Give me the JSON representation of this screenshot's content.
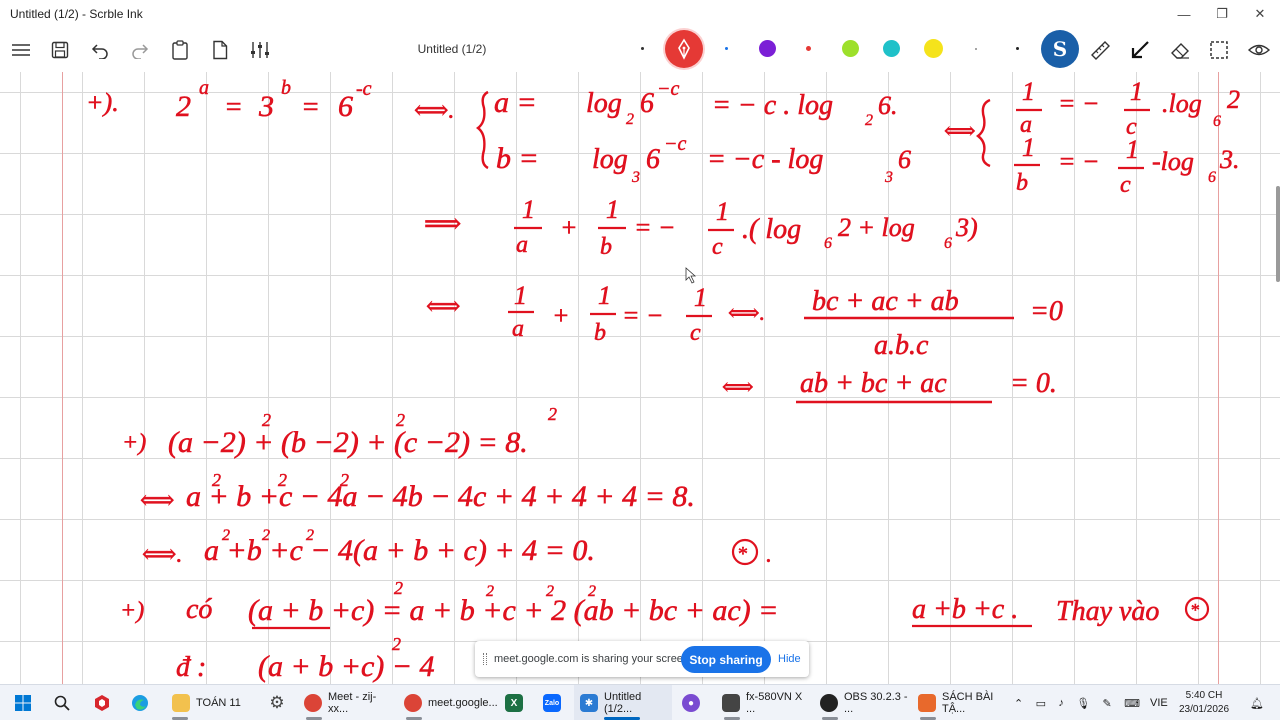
{
  "window": {
    "title": "Untitled (1/2) - Scrble Ink",
    "minimize": "—",
    "maximize": "❐",
    "close": "✕"
  },
  "toolbar": {
    "document_title": "Untitled (1/2)",
    "active_pen_color": "#e53935",
    "swatches": [
      "#7b1fd6",
      "#e53935",
      "#9de02b",
      "#1fc1c9",
      "#f5e31b"
    ],
    "active_tool_glyph": "S"
  },
  "share_bar": {
    "message": "meet.google.com is sharing your screen.",
    "stop_label": "Stop sharing",
    "hide_label": "Hide"
  },
  "taskbar": {
    "items": [
      {
        "label": "TOÁN 11",
        "icon": "folder-icon",
        "color": "#f2c14e"
      },
      {
        "label": "Meet - zij-xx...",
        "icon": "chrome-icon",
        "color": "#db4437"
      },
      {
        "label": "meet.google...",
        "icon": "chrome-icon",
        "color": "#db4437"
      },
      {
        "label": "Untitled (1/2...",
        "icon": "scrble-icon",
        "color": "#2b7bd3"
      },
      {
        "label": "fx-580VN X ...",
        "icon": "calculator-icon",
        "color": "#444"
      },
      {
        "label": "OBS 30.2.3 - ...",
        "icon": "obs-icon",
        "color": "#222"
      },
      {
        "label": "SÁCH BÀI TẬ...",
        "icon": "pdf-icon",
        "color": "#e8692c"
      }
    ],
    "language": "VIE",
    "time": "5:40 CH",
    "date": "23/01/2026"
  }
}
